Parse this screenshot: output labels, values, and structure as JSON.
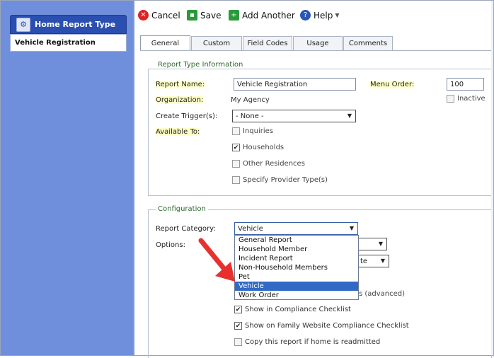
{
  "sidebar": {
    "header_title": "Home Report Type",
    "items": [
      {
        "label": "Vehicle Registration"
      }
    ]
  },
  "toolbar": {
    "cancel_label": "Cancel",
    "save_label": "Save",
    "add_another_label": "Add Another",
    "help_label": "Help"
  },
  "tabs": [
    {
      "label": "General"
    },
    {
      "label": "Custom"
    },
    {
      "label": "Field Codes"
    },
    {
      "label": "Usage"
    },
    {
      "label": "Comments"
    }
  ],
  "report_type_info": {
    "legend": "Report Type Information",
    "report_name_label": "Report Name:",
    "report_name_value": "Vehicle Registration",
    "menu_order_label": "Menu Order:",
    "menu_order_value": "100",
    "inactive_label": "Inactive",
    "organization_label": "Organization:",
    "organization_value": "My Agency",
    "create_trigger_label": "Create Trigger(s):",
    "create_trigger_value": "- None -",
    "available_to_label": "Available To:",
    "available_options": [
      {
        "label": "Inquiries",
        "checked": false
      },
      {
        "label": "Households",
        "checked": true
      },
      {
        "label": "Other Residences",
        "checked": false
      },
      {
        "label": "Specify Provider Type(s)",
        "checked": false
      }
    ]
  },
  "configuration": {
    "legend": "Configuration",
    "report_category_label": "Report Category:",
    "report_category_value": "Vehicle",
    "options_label": "Options:",
    "partial_option_a": "te",
    "partial_option_b": "s (advanced)",
    "category_options": [
      "General Report",
      "Household Member",
      "Incident Report",
      "Non-Household Members",
      "Pet",
      "Vehicle",
      "Work Order"
    ],
    "selected_index": 5,
    "checkboxes": [
      {
        "label": "Show in Compliance Checklist",
        "checked": true
      },
      {
        "label": "Show on Family Website Compliance Checklist",
        "checked": true
      },
      {
        "label": "Copy this report if home is readmitted",
        "checked": false
      }
    ]
  },
  "colors": {
    "sidebar_bg": "#6f8fdc",
    "sidebar_header": "#2a4fb0",
    "highlight_label": "#ffffc8",
    "legend_text": "#2b6b2b",
    "selected_option": "#3169c6",
    "annotation_arrow": "#e8312e"
  },
  "icons": {
    "sidebar_header_icon": "gear-document-icon",
    "cancel": "cancel-icon",
    "save": "save-icon",
    "add_another": "add-icon",
    "help": "help-icon"
  }
}
